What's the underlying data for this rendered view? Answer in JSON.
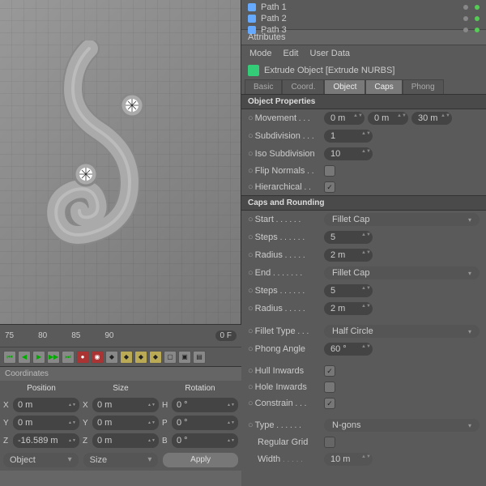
{
  "tree": {
    "items": [
      {
        "label": "Path 1"
      },
      {
        "label": "Path 2"
      },
      {
        "label": "Path 3"
      }
    ]
  },
  "attributes": {
    "title": "Attributes",
    "menu": [
      "Mode",
      "Edit",
      "User Data"
    ]
  },
  "object": {
    "title": "Extrude Object [Extrude NURBS]",
    "tabs": [
      "Basic",
      "Coord.",
      "Object",
      "Caps",
      "Phong"
    ]
  },
  "sections": {
    "props": "Object Properties",
    "caps": "Caps and Rounding"
  },
  "props": {
    "movement": {
      "label": "Movement",
      "x": "0 m",
      "y": "0 m",
      "z": "30 m"
    },
    "subdivision": {
      "label": "Subdivision",
      "value": "1"
    },
    "iso": {
      "label": "Iso Subdivision",
      "value": "10"
    },
    "flip": {
      "label": "Flip Normals",
      "checked": false
    },
    "hier": {
      "label": "Hierarchical",
      "checked": true
    }
  },
  "caps": {
    "start": {
      "label": "Start",
      "value": "Fillet Cap"
    },
    "steps1": {
      "label": "Steps",
      "value": "5"
    },
    "radius1": {
      "label": "Radius",
      "value": "2 m"
    },
    "end": {
      "label": "End",
      "value": "Fillet Cap"
    },
    "steps2": {
      "label": "Steps",
      "value": "5"
    },
    "radius2": {
      "label": "Radius",
      "value": "2 m"
    },
    "fillet": {
      "label": "Fillet Type",
      "value": "Half Circle"
    },
    "phong": {
      "label": "Phong Angle",
      "value": "60 °"
    },
    "hull": {
      "label": "Hull Inwards",
      "checked": true
    },
    "hole": {
      "label": "Hole Inwards",
      "checked": false
    },
    "constrain": {
      "label": "Constrain",
      "checked": true
    },
    "type": {
      "label": "Type",
      "value": "N-gons"
    },
    "grid": {
      "label": "Regular Grid",
      "checked": false
    },
    "width": {
      "label": "Width",
      "value": "10 m"
    }
  },
  "timeline": {
    "ticks": [
      "75",
      "80",
      "85",
      "90"
    ],
    "temp": "0 F"
  },
  "coords": {
    "title": "Coordinates",
    "headers": [
      "Position",
      "Size",
      "Rotation"
    ],
    "rows": [
      {
        "a": "X",
        "av": "0 m",
        "b": "X",
        "bv": "0 m",
        "c": "H",
        "cv": "0 °"
      },
      {
        "a": "Y",
        "av": "0 m",
        "b": "Y",
        "bv": "0 m",
        "c": "P",
        "cv": "0 °"
      },
      {
        "a": "Z",
        "av": "-16.589 m",
        "b": "Z",
        "bv": "0 m",
        "c": "B",
        "cv": "0 °"
      }
    ],
    "dd1": "Object",
    "dd2": "Size",
    "apply": "Apply"
  }
}
